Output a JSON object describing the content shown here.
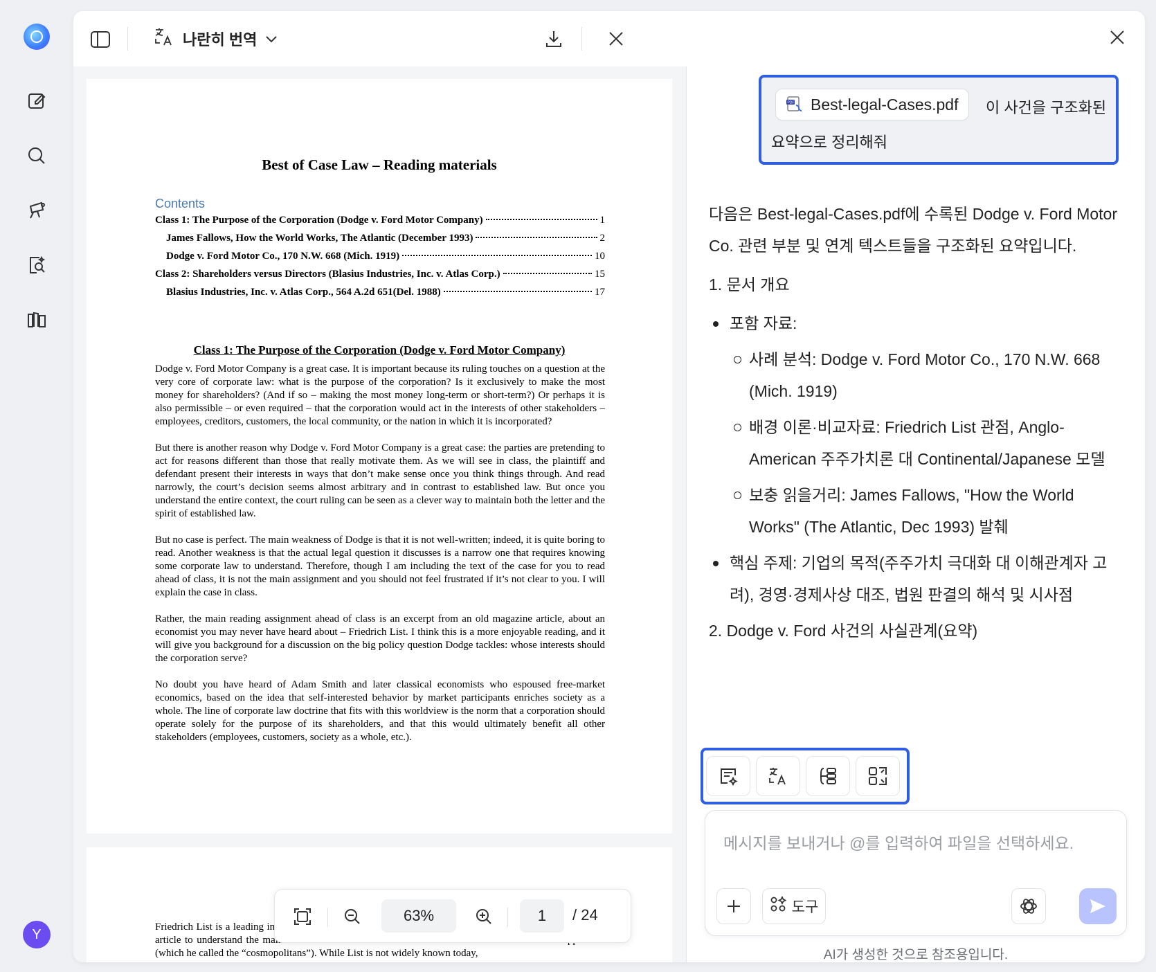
{
  "header": {
    "translate_title": "나란히 번역"
  },
  "pdf": {
    "title": "Best of Case Law – Reading materials",
    "contents_heading": "Contents",
    "toc": [
      {
        "label": "Class 1: The Purpose of the Corporation (Dodge v. Ford Motor Company)",
        "page": "1",
        "level": 1
      },
      {
        "label": "James Fallows, How the World Works, The Atlantic (December 1993)",
        "page": "2",
        "level": 2
      },
      {
        "label": "Dodge v. Ford Motor Co., 170 N.W. 668 (Mich. 1919)",
        "page": "10",
        "level": 2
      },
      {
        "label": "Class 2: Shareholders versus Directors (Blasius Industries, Inc. v. Atlas Corp.)",
        "page": "15",
        "level": 1
      },
      {
        "label": "Blasius Industries, Inc. v. Atlas Corp., 564 A.2d 651(Del. 1988)",
        "page": "17",
        "level": 2
      }
    ],
    "section_heading": "Class 1: The Purpose of the Corporation (Dodge v. Ford Motor Company)",
    "paragraphs": [
      "Dodge v. Ford Motor Company is a great case.  It is important because its ruling touches on a question at the very core of corporate law: what is the purpose of the corporation?  Is it exclusively to make the most money for shareholders? (And if so – making the most money long-term or short-term?)  Or perhaps it is also permissible – or even required – that the corporation would act in the interests of other stakeholders – employees, creditors, customers, the local community, or the nation in which it is incorporated?",
      "But there is another reason why Dodge v. Ford Motor Company is a great case: the parties are pretending to act for reasons different than those that really motivate them.  As we will see in class, the plaintiff and defendant present their interests in ways that don’t make sense once you think things through.  And read narrowly, the court’s decision seems almost arbitrary and in contrast to established law.  But once you understand the entire context, the court ruling can be seen as a clever way to maintain both the letter and the spirit of established law.",
      "But no case is perfect.  The main weakness of Dodge is that it is not well-written; indeed, it is quite boring to read.  Another weakness is that the actual legal question it discusses is a narrow one that requires knowing some corporate law to understand.  Therefore, though I am including the text of the case for you to read ahead of class, it is not the main assignment and you should not feel frustrated if it’s not clear to you.  I will explain the case in class.",
      "Rather, the main reading assignment ahead of class is an excerpt from an old magazine article, about an economist you may never have heard about – Friedrich List.  I think this is a more enjoyable reading, and it will give you background for a discussion on the big policy question Dodge tackles: whose interests should the corporation serve?",
      "No doubt you have heard of Adam Smith and later classical economists who espoused free-market economics, based on the idea that self-interested behavior by market participants enriches society as a whole.  The line of corporate law doctrine that fits with this worldview is the norm that a corporation should operate solely for the purpose of its shareholders, and that this would ultimately benefit all other stakeholders (employees, customers, society as a whole, etc.)."
    ],
    "page2_paragraph": "Friedrich List is a leading intellectual force behind an opposing view, which is why I ask that you read the article to understand the main differences between his world view and that of his free-market opponents (which he called the “cosmopolitans”).  While List is not widely known today,",
    "zoom": "63%",
    "current_page": "1",
    "total_pages": "/ 24"
  },
  "chat": {
    "file_name": "Best-legal-Cases.pdf",
    "user_text_1": "이 사건을 구조화된",
    "user_text_2": "요약으로 정리해줘",
    "intro": "다음은 Best-legal-Cases.pdf에 수록된 Dodge v. Ford Motor Co. 관련 부분 및 연계 텍스트들을 구조화된 요약입니다.",
    "section1": "1. 문서 개요",
    "bullet_materials": "포함 자료:",
    "sub_1": "사례 분석: Dodge v. Ford Motor Co., 170 N.W. 668 (Mich. 1919)",
    "sub_2": "배경 이론·비교자료: Friedrich List 관점, Anglo-American 주주가치론 대 Continental/Japanese 모델",
    "sub_3": "보충 읽을거리: James Fallows, \"How the World Works\" (The Atlantic, Dec 1993) 발췌",
    "bullet_core": "핵심 주제: 기업의 목적(주주가치 극대화 대 이해관계자 고려), 경영·경제사상 대조, 법원 판결의 해석 및 시사점",
    "section2": "2. Dodge v. Ford 사건의 사실관계(요약)",
    "input_placeholder": "메시지를 보내거나 @를 입력하여 파일을 선택하세요.",
    "tools_label": "도구",
    "disclaimer": "AI가 생성한 것으로 참조용입니다."
  },
  "user": {
    "avatar_initial": "Y"
  },
  "colors": {
    "accent": "#2f5fe0",
    "send": "#b9c4ff",
    "contents_link": "#4a7bb0"
  }
}
